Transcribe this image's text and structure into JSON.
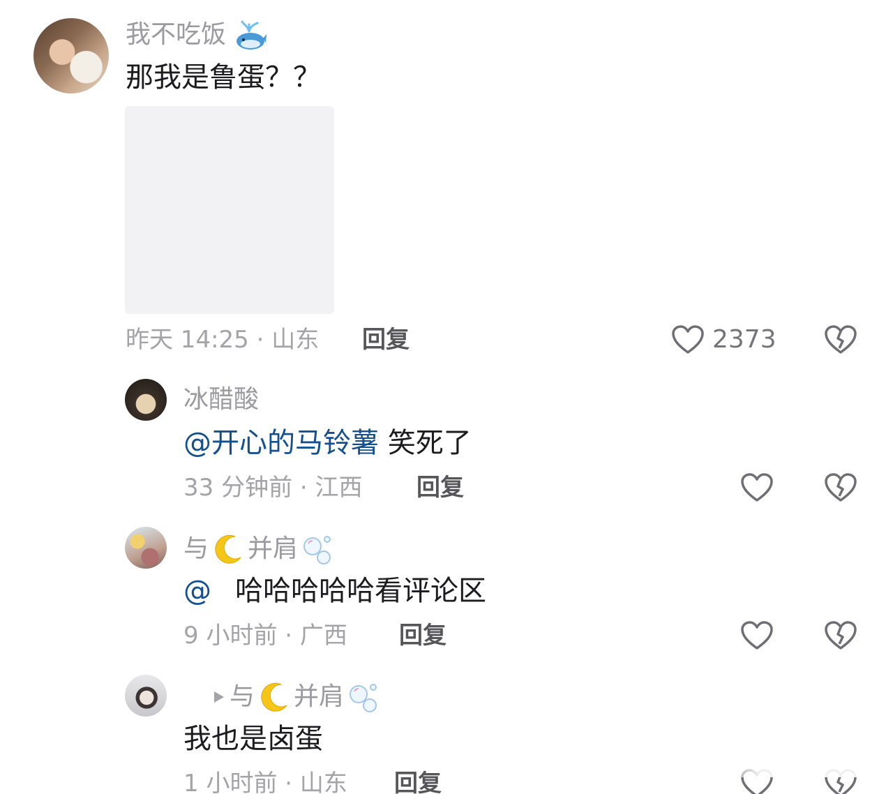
{
  "main_comment": {
    "username": "我不吃饭",
    "username_emoji": "whale-icon",
    "text": "那我是鲁蛋？？",
    "time_location": "昨天 14:25 · 山东",
    "reply_label": "回复",
    "like_count": "2373"
  },
  "replies": [
    {
      "username": "冰醋酸",
      "mention": "@开心的马铃薯",
      "text": "笑死了",
      "time_location": "33 分钟前 · 江西",
      "reply_label": "回复"
    },
    {
      "username_prefix": "与",
      "username_suffix": "并肩",
      "username_emojis": [
        "crescent-moon-icon",
        "bubbles-icon"
      ],
      "mention": "@",
      "text": "哈哈哈哈哈看评论区",
      "time_location": "9 小时前 · 广西",
      "reply_label": "回复"
    },
    {
      "reply_to_prefix": "与",
      "reply_to_suffix": "并肩",
      "reply_to_emojis": [
        "crescent-moon-icon",
        "bubbles-icon"
      ],
      "text": "我也是卤蛋",
      "time_location": "1 小时前 · 山东",
      "reply_label": "回复"
    }
  ],
  "colors": {
    "mention": "#14508e",
    "username": "#9a9aa0",
    "meta": "#a3a3a8",
    "text": "#1c1c1e"
  }
}
